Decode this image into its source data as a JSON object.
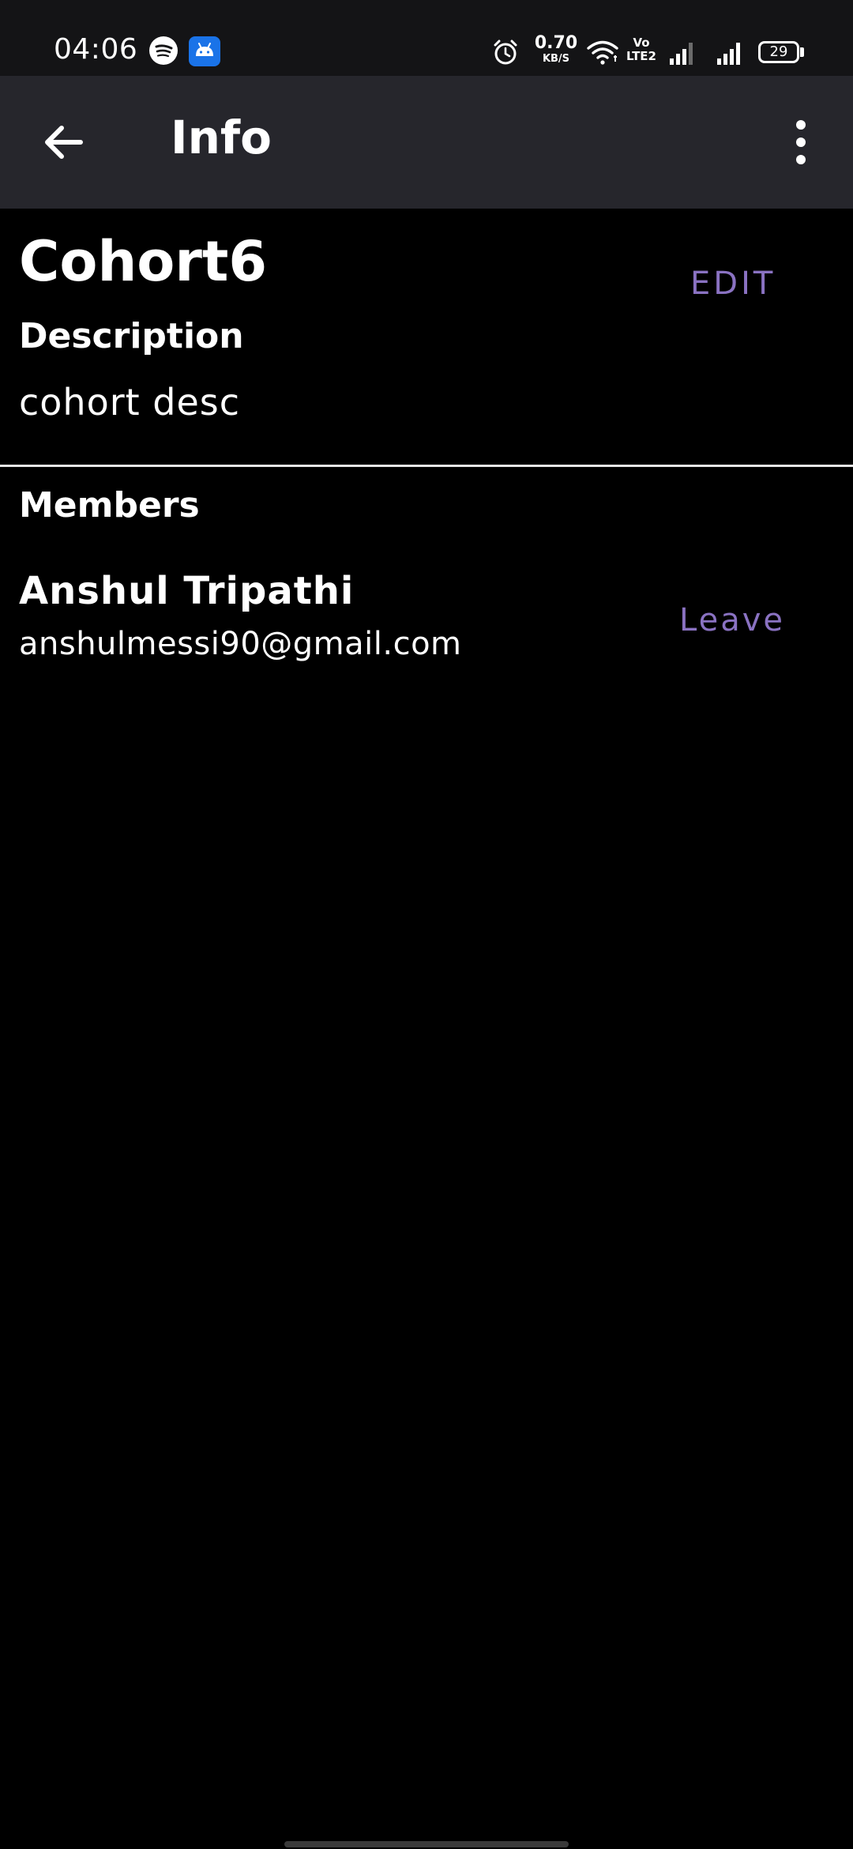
{
  "status_bar": {
    "time": "04:06",
    "icons": [
      "spotify-icon",
      "android-icon",
      "alarm-icon",
      "wifi-icon",
      "signal-icon",
      "signal-icon"
    ],
    "net_speed_value": "0.70",
    "net_speed_unit": "KB/S",
    "volte_top": "Vo",
    "volte_bottom": "LTE2",
    "battery": "29"
  },
  "app_bar": {
    "title": "Info",
    "back_icon": "arrow-back-icon",
    "menu_icon": "more-vert-icon"
  },
  "cohort": {
    "name": "Cohort6",
    "edit_label": "EDIT",
    "description_label": "Description",
    "description": "cohort desc"
  },
  "members": {
    "label": "Members",
    "items": [
      {
        "name": "Anshul Tripathi",
        "email": "anshulmessi90@gmail.com",
        "action_label": "Leave"
      }
    ]
  },
  "colors": {
    "background": "#000000",
    "app_bar": "#26262c",
    "status_bar": "#141416",
    "accent": "#8a72c2",
    "text": "#ffffff"
  }
}
